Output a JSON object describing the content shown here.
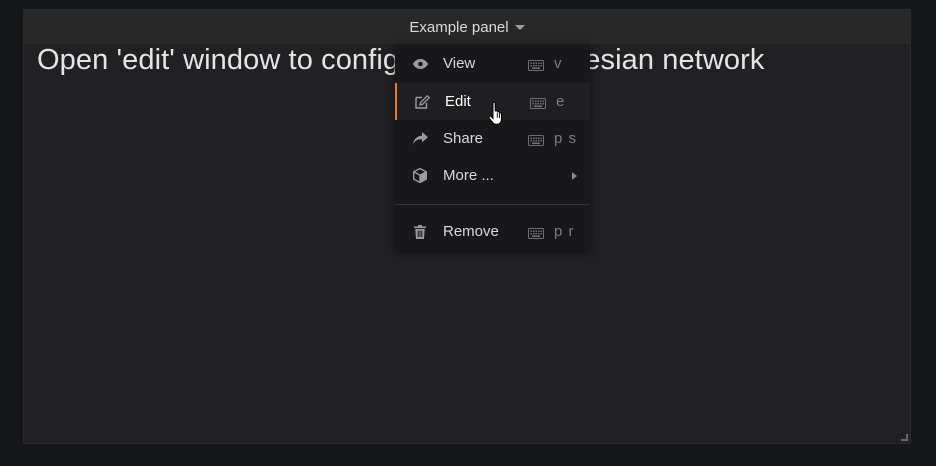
{
  "panel": {
    "title": "Example panel",
    "text": "Open 'edit' window to configure with a Bayesian network"
  },
  "menu": {
    "items": [
      {
        "label": "View",
        "shortcut": "v",
        "icon": "eye-icon"
      },
      {
        "label": "Edit",
        "shortcut": "e",
        "icon": "edit-icon"
      },
      {
        "label": "Share",
        "shortcut": "p s",
        "icon": "share-icon"
      },
      {
        "label": "More ...",
        "shortcut": "",
        "icon": "cube-icon"
      },
      {
        "label": "Remove",
        "shortcut": "p r",
        "icon": "trash-icon"
      }
    ]
  },
  "colors": {
    "accent": "#eb7b18",
    "panel_bg": "#212124",
    "menu_bg": "#18181b"
  }
}
